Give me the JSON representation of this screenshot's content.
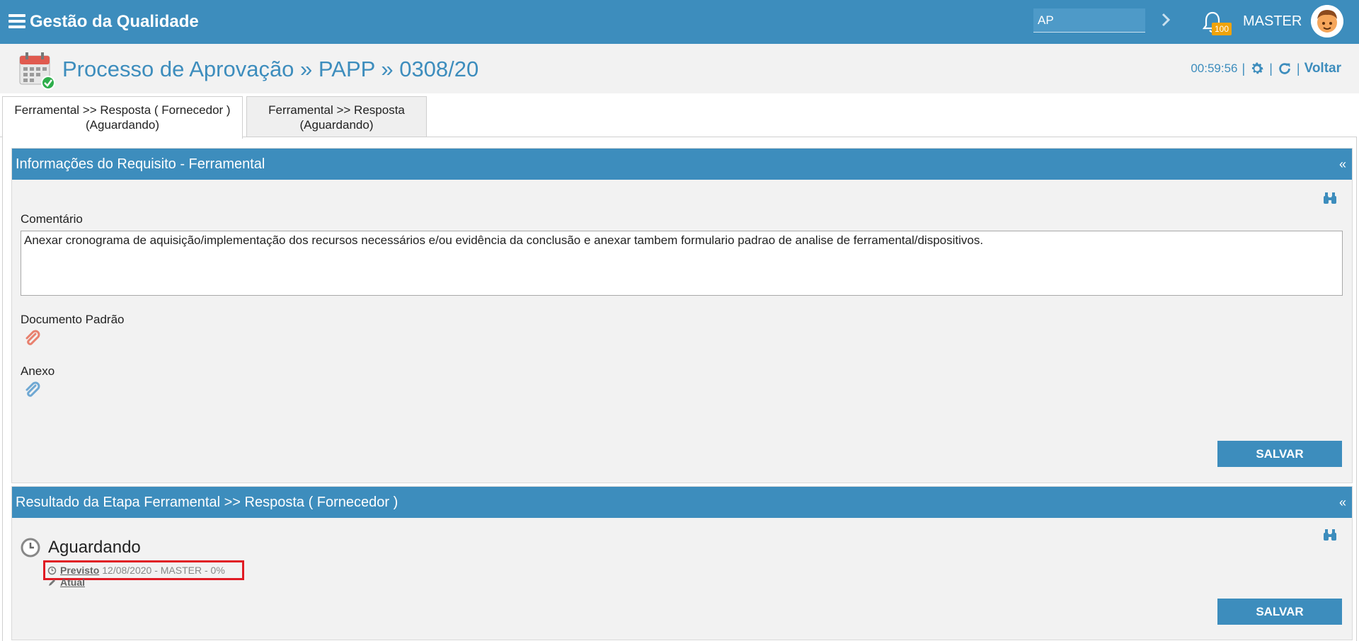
{
  "topbar": {
    "title": "Gestão da Qualidade",
    "search_value": "AP",
    "notification_count": "100",
    "user": "MASTER"
  },
  "header": {
    "title": "Processo de Aprovação » PAPP » 0308/20",
    "timer": "00:59:56",
    "back_label": "Voltar"
  },
  "tabs": [
    {
      "label": "Ferramental >> Resposta ( Fornecedor ) (Aguardando)"
    },
    {
      "label": "Ferramental >> Resposta (Aguardando)"
    }
  ],
  "panel_info": {
    "title": "Informações do Requisito - Ferramental",
    "collapse": "«",
    "comment_label": "Comentário",
    "comment_value": "Anexar cronograma de aquisição/implementação dos recursos necessários e/ou evidência da conclusão e anexar tambem formulario padrao de analise de ferramental/dispositivos.",
    "doc_label": "Documento Padrão",
    "attachment_label": "Anexo",
    "save_label": "SALVAR"
  },
  "panel_result": {
    "title": "Resultado da Etapa Ferramental >> Resposta ( Fornecedor )",
    "collapse": "«",
    "status": "Aguardando",
    "planned_link": "Previsto",
    "planned_detail": "12/08/2020 - MASTER - 0%",
    "current_link": "Atual",
    "save_label": "SALVAR"
  },
  "colors": {
    "primary": "#3d8dbd",
    "badge": "#f0a30a",
    "highlight": "#e01b24"
  }
}
